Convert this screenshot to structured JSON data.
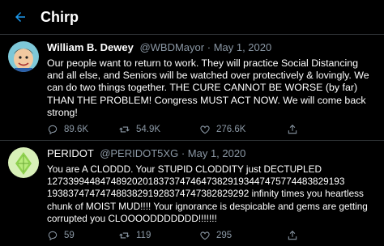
{
  "header": {
    "title": "Chirp",
    "back_icon": "arrow-left-icon",
    "accent": "#1d9bf0"
  },
  "tweets": [
    {
      "name": "William B. Dewey",
      "handle": "@WBDMayor",
      "separator": "·",
      "date": "May 1, 2020",
      "text": "Our people want to return to work. They will practice Social Distancing and all else, and Seniors will be watched over protectively & lovingly. We can do two things together. THE CURE CANNOT BE WORSE (by far) THAN THE PROBLEM! Congress MUST ACT NOW. We will come back strong!",
      "replies": "89.6K",
      "retweets": "54.9K",
      "likes": "276.6K"
    },
    {
      "name": "PERIDOT",
      "handle": "@PERIDOT5XG",
      "separator": "·",
      "date": "May 1, 2020",
      "text": "You are A CLODDD. Your STUPID CLODDITY just DECTUPLED\n12733994484748920201837374746473829193447475774483829193\n19383747474748838291928374747382829292 infinity times you heartless chunk of MOIST MUD!!!! Your ignorance is despicable and gems are getting corrupted you CLOOOODDDDDDD!!!!!!!",
      "replies": "59",
      "retweets": "119",
      "likes": "295"
    }
  ],
  "colors": {
    "background": "#000000",
    "divider": "#2f3336",
    "muted": "#8b98a5"
  },
  "icons": [
    "reply-icon",
    "retweet-icon",
    "like-icon",
    "share-icon"
  ]
}
